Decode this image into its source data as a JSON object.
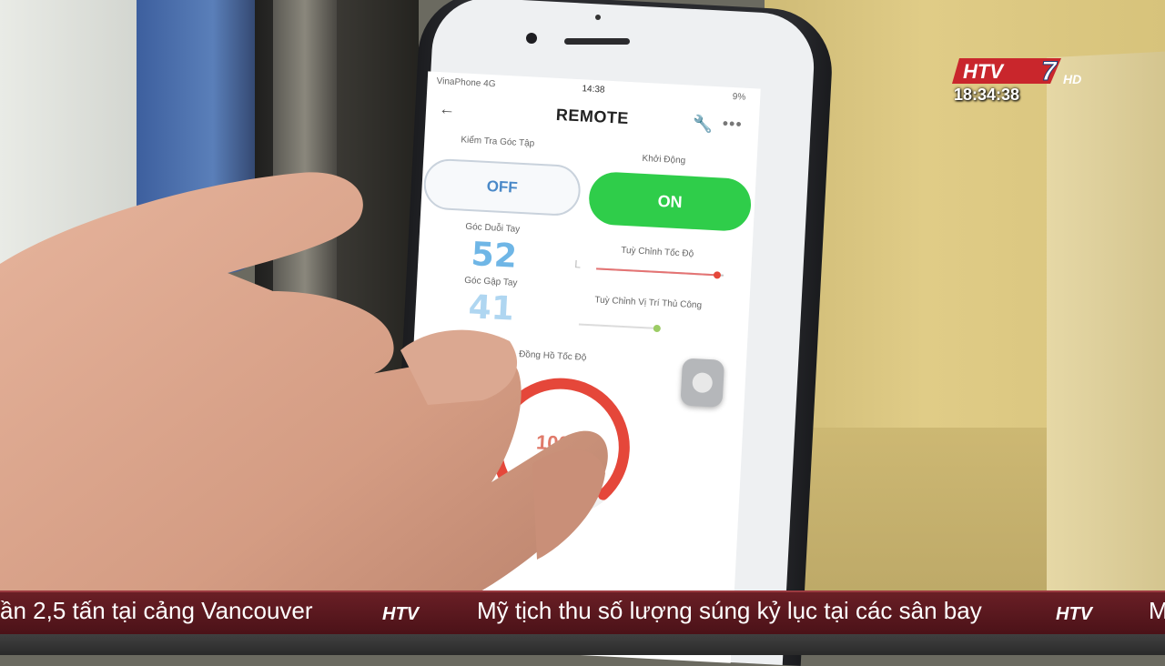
{
  "app": {
    "status_carrier": "VinaPhone 4G",
    "status_time": "14:38",
    "status_right": "9%",
    "title": "REMOTE",
    "back_icon": "arrow-left-icon",
    "wrench_icon": "wrench-icon",
    "more_icon": "more-icon"
  },
  "controls": {
    "check_angle_label": "Kiểm Tra Góc Tập",
    "off_label": "OFF",
    "start_label": "Khởi Động",
    "on_label": "ON",
    "extend_angle_label": "Góc Duỗi Tay",
    "extend_angle_value": "52",
    "speed_adjust_label": "Tuỳ Chỉnh Tốc Độ",
    "speed_slider_start": "L",
    "speed_slider_value": 0.95,
    "bend_angle_label": "Góc Gập Tay",
    "bend_angle_value": "41",
    "position_adjust_label": "Tuỳ Chỉnh Vị Trí Thủ Công",
    "position_slider_value": 0.95,
    "speedometer_label": "Đồng Hồ Tốc Độ",
    "speedometer_value": "100%",
    "speedometer_fraction": 1.0
  },
  "broadcast": {
    "channel_logo": "HTV7 HD",
    "clock": "18:34:38",
    "ticker": [
      "ần 2,5 tấn tại cảng Vancouver",
      "Mỹ tịch thu số lượng súng kỷ lục tại các sân bay",
      "M"
    ],
    "ticker_logo": "htv-logo-icon"
  },
  "colors": {
    "on_green": "#2fcd4a",
    "off_blue": "#4a89c8",
    "gauge_red": "#e5473a",
    "ticker_bg": "#5a1a20"
  }
}
